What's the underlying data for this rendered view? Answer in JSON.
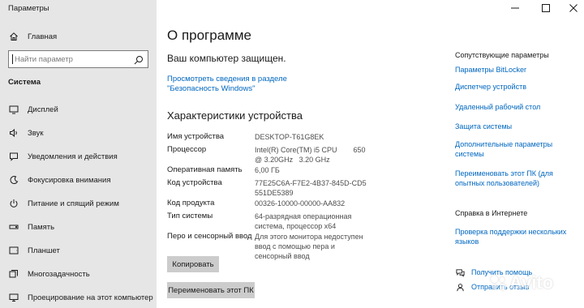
{
  "window": {
    "title": "Параметры",
    "controls": [
      "minimize-icon",
      "maximize-icon",
      "close-icon"
    ]
  },
  "sidebar": {
    "home_label": "Главная",
    "search_placeholder": "Найти параметр",
    "section_title": "Система",
    "items": [
      {
        "label": "Дисплей",
        "icon": "display-icon"
      },
      {
        "label": "Звук",
        "icon": "sound-icon"
      },
      {
        "label": "Уведомления и действия",
        "icon": "notifications-icon"
      },
      {
        "label": "Фокусировка внимания",
        "icon": "focus-assist-icon"
      },
      {
        "label": "Питание и спящий режим",
        "icon": "power-icon"
      },
      {
        "label": "Память",
        "icon": "storage-icon"
      },
      {
        "label": "Планшет",
        "icon": "tablet-icon"
      },
      {
        "label": "Многозадачность",
        "icon": "multitasking-icon"
      },
      {
        "label": "Проецирование на этот компьютер",
        "icon": "projecting-icon"
      }
    ]
  },
  "main": {
    "title": "О программе",
    "protected_text": "Ваш компьютер защищен.",
    "security_link": "Просмотреть сведения в разделе \"Безопасность Windows\"",
    "specs_title": "Характеристики устройства",
    "specs": [
      {
        "label": "Имя устройства",
        "value": "DESKTOP-T61G8EK"
      },
      {
        "label": "Процессор",
        "value": "Intel(R) Core(TM) i5 CPU        650  @ 3.20GHz   3.20 GHz"
      },
      {
        "label": "Оперативная память",
        "value": "6,00 ГБ"
      },
      {
        "label": "Код устройства",
        "value": "77E25C6A-F7E2-4B37-845D-CD5551DE5389"
      },
      {
        "label": "Код продукта",
        "value": "00326-10000-00000-AA832"
      },
      {
        "label": "Тип системы",
        "value": "64-разрядная операционная система, процессор x64"
      },
      {
        "label": "Перо и сенсорный ввод",
        "value": "Для этого монитора недоступен ввод с помощью пера и сенсорный ввод"
      }
    ],
    "copy_button": "Копировать",
    "rename_button": "Переименовать этот ПК"
  },
  "related": {
    "heading": "Сопутствующие параметры",
    "links": [
      "Параметры BitLocker",
      "Диспетчер устройств",
      "Удаленный рабочий стол",
      "Защита системы",
      "Дополнительные параметры системы",
      "Переименовать этот ПК (для опытных пользователей)"
    ],
    "help_heading": "Справка в Интернете",
    "help_link": "Проверка поддержки нескольких языков",
    "get_help": "Получить помощь",
    "feedback": "Отправить отзыв"
  },
  "watermark": {
    "text": "Avito"
  },
  "colors": {
    "sidebar_bg": "#e6e6e6",
    "link": "#0067c0",
    "button_bg": "#cccccc"
  }
}
